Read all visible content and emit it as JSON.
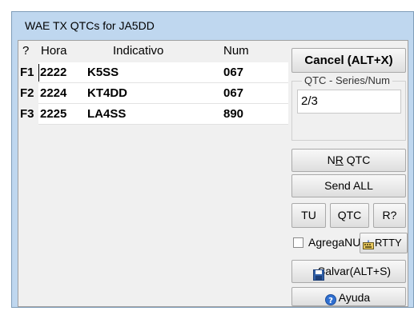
{
  "window": {
    "title": "WAE TX QTCs for JA5DD"
  },
  "grid": {
    "headers": {
      "key": "?",
      "time": "Hora",
      "call": "Indicativo",
      "num": "Num"
    },
    "rows": [
      {
        "key": "F1",
        "time": "2222",
        "call": "K5SS",
        "num": "067"
      },
      {
        "key": "F2",
        "time": "2224",
        "call": "KT4DD",
        "num": "067"
      },
      {
        "key": "F3",
        "time": "2225",
        "call": "LA4SS",
        "num": "890"
      }
    ]
  },
  "panel": {
    "cancel_label": "Cancel (ALT+X)",
    "series_group_label": "QTC - Series/Num",
    "series_value": "2/3",
    "nr_qtc_label": {
      "before": "N",
      "underlined": "R",
      "after": " QTC"
    },
    "send_all_label": "Send ALL",
    "tu_label": "TU",
    "qtc_label": "QTC",
    "rq_label": "R?",
    "agrega_label": "AgregaNU",
    "agrega_checked": false,
    "rtty_label": "RTTY",
    "save_label": "Salvar(ALT+S)",
    "help_label": "Ayuda"
  },
  "colors": {
    "titlebar": "#bfd7ef",
    "client": "#f0f0f0",
    "save_icon": "#2f5fa8",
    "help_icon": "#2f6fd1"
  },
  "icons": {
    "save": "floppy-disk-icon",
    "help": "question-mark-icon",
    "rtty": "keyboard-icon"
  }
}
